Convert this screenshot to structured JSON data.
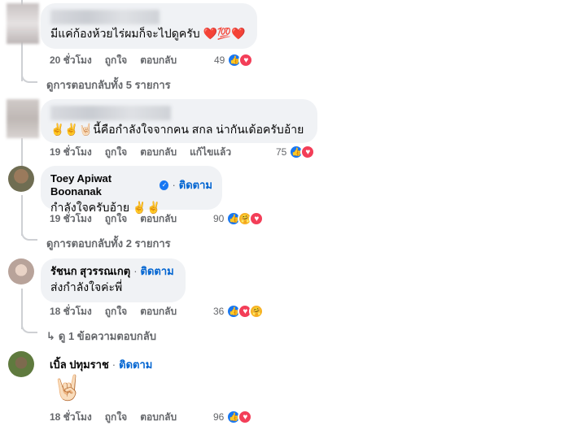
{
  "c1": {
    "text": "มีแค่ก้องห้วยไร่ผมก็จะไปดูครับ ❤️💯❤️",
    "time": "20 ชั่วโมง",
    "like": "ถูกใจ",
    "reply": "ตอบกลับ",
    "count": "49"
  },
  "more1": "ดูการตอบกลับทั้ง 5 รายการ",
  "c2": {
    "text": "✌️✌️🤘🏻นี้คือกำลังใจจากคน สกล น่ากันเด้อครับอ้าย",
    "time": "19 ชั่วโมง",
    "like": "ถูกใจ",
    "reply": "ตอบกลับ",
    "edited": "แก้ไขแล้ว",
    "count": "75"
  },
  "c3": {
    "author": "Toey Apiwat Boonanak",
    "follow": "ติดตาม",
    "text": "กำลังใจครับอ้าย ✌️✌️",
    "time": "19 ชั่วโมง",
    "like": "ถูกใจ",
    "reply": "ตอบกลับ",
    "count": "90"
  },
  "more2": "ดูการตอบกลับทั้ง 2 รายการ",
  "c4": {
    "author": "รัชนก สุวรรณเกตุ",
    "follow": "ติดตาม",
    "text": "ส่งกำลังใจค่ะพี่",
    "time": "18 ชั่วโมง",
    "like": "ถูกใจ",
    "reply": "ตอบกลับ",
    "count": "36"
  },
  "more3": "ดู 1 ข้อความตอบกลับ",
  "c5": {
    "author": "เบิ้ล ปทุมราช",
    "follow": "ติดตาม",
    "emoji": "🤘🏻",
    "time": "18 ชั่วโมง",
    "like": "ถูกใจ",
    "reply": "ตอบกลับ",
    "count": "96"
  },
  "icons": {
    "like": "like-icon",
    "love": "love-icon",
    "care": "care-icon",
    "verified": "verified-badge-icon",
    "reply_arrow": "reply-arrow-icon"
  },
  "colors": {
    "bubble": "#f0f2f5",
    "link": "#0064d1",
    "meta": "#65676b",
    "like": "#1877f2",
    "love": "#f33e58"
  }
}
